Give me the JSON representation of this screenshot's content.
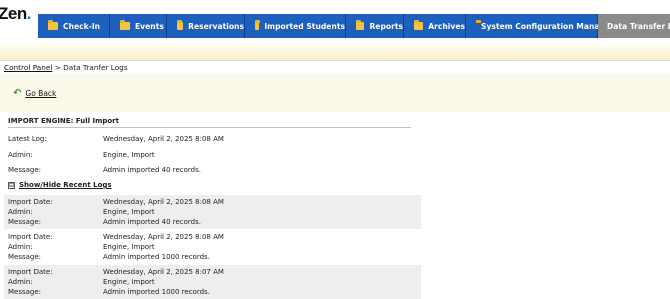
{
  "app": {
    "logo_text": "Zen",
    "logo_dot": "."
  },
  "nav": {
    "tabs": [
      {
        "label": "Check-In"
      },
      {
        "label": "Events"
      },
      {
        "label": "Reservations"
      },
      {
        "label": "Imported Students"
      },
      {
        "label": "Reports"
      },
      {
        "label": "Archives"
      },
      {
        "label": "System Configuration Manager"
      },
      {
        "label": "Data Transfer Logs",
        "active": true
      }
    ]
  },
  "breadcrumb": {
    "link": "Control Panel",
    "separator": " > ",
    "current": "Data Tranfer Logs"
  },
  "go_back": {
    "label": "Go Back"
  },
  "section": {
    "title": "IMPORT ENGINE: Full Import"
  },
  "summary": {
    "latest_log_label": "Latest Log:",
    "latest_log_value": "Wednesday, April 2, 2025 8:08 AM",
    "admin_label": "Admin:",
    "admin_value": "Engine, Import",
    "message_label": "Message:",
    "message_value": "Admin imported 40 records."
  },
  "toggle": {
    "icon": "⊟",
    "label": "Show/Hide Recent Logs"
  },
  "logs": [
    {
      "date_label": "Import Date:",
      "date": "Wednesday, April 2, 2025 8:08 AM",
      "admin_label": "Admin:",
      "admin": "Engine, Import",
      "message_label": "Message:",
      "message": "Admin imported 40 records."
    },
    {
      "date_label": "Import Date:",
      "date": "Wednesday, April 2, 2025 8:08 AM",
      "admin_label": "Admin:",
      "admin": "Engine, Import",
      "message_label": "Message:",
      "message": "Admin imported 1000 records."
    },
    {
      "date_label": "Import Date:",
      "date": "Wednesday, April 2, 2025 8:07 AM",
      "admin_label": "Admin:",
      "admin": "Engine, Import",
      "message_label": "Message:",
      "message": "Admin imported 1000 records."
    }
  ],
  "colors": {
    "nav_blue": "#1d5fbd",
    "nav_active": "#8a8a8a",
    "folder": "#f4c542",
    "shade": "#eeeeee"
  }
}
